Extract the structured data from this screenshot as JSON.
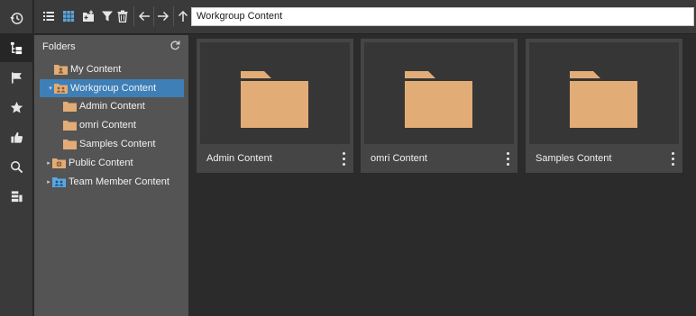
{
  "rail": {
    "items": [
      {
        "icon": "history-icon"
      },
      {
        "icon": "folder-tree-icon",
        "active": true
      },
      {
        "icon": "flag-icon"
      },
      {
        "icon": "star-icon"
      },
      {
        "icon": "thumbs-up-icon"
      },
      {
        "icon": "search-icon"
      },
      {
        "icon": "catalog-icon"
      }
    ]
  },
  "toolbar": {
    "buttons": [
      "list-view-icon",
      "grid-view-icon",
      "new-folder-icon",
      "filter-icon",
      "delete-icon",
      "back-icon",
      "forward-icon",
      "up-icon"
    ],
    "path": "Workgroup Content"
  },
  "folders": {
    "title": "Folders",
    "tree": [
      {
        "label": "My Content",
        "expander": "",
        "icon": "user-folder-icon",
        "depth": 1
      },
      {
        "label": "Workgroup Content",
        "expander": "▾",
        "icon": "group-folder-icon",
        "depth": 1,
        "selected": true
      },
      {
        "label": "Admin Content",
        "expander": "",
        "icon": "folder-icon",
        "depth": 2
      },
      {
        "label": "omri Content",
        "expander": "",
        "icon": "folder-icon",
        "depth": 2
      },
      {
        "label": "Samples Content",
        "expander": "",
        "icon": "folder-icon",
        "depth": 2
      },
      {
        "label": "Public Content",
        "expander": "▸",
        "icon": "public-folder-icon",
        "depth": 1
      },
      {
        "label": "Team Member Content",
        "expander": "▸",
        "icon": "team-folder-icon",
        "depth": 1
      }
    ]
  },
  "tiles": [
    {
      "name": "Admin Content"
    },
    {
      "name": "omri Content"
    },
    {
      "name": "Samples Content"
    }
  ],
  "colors": {
    "folder": "#e2ac77",
    "selection": "#3e7fb8",
    "panel": "#545454",
    "background": "#2b2b2b"
  }
}
